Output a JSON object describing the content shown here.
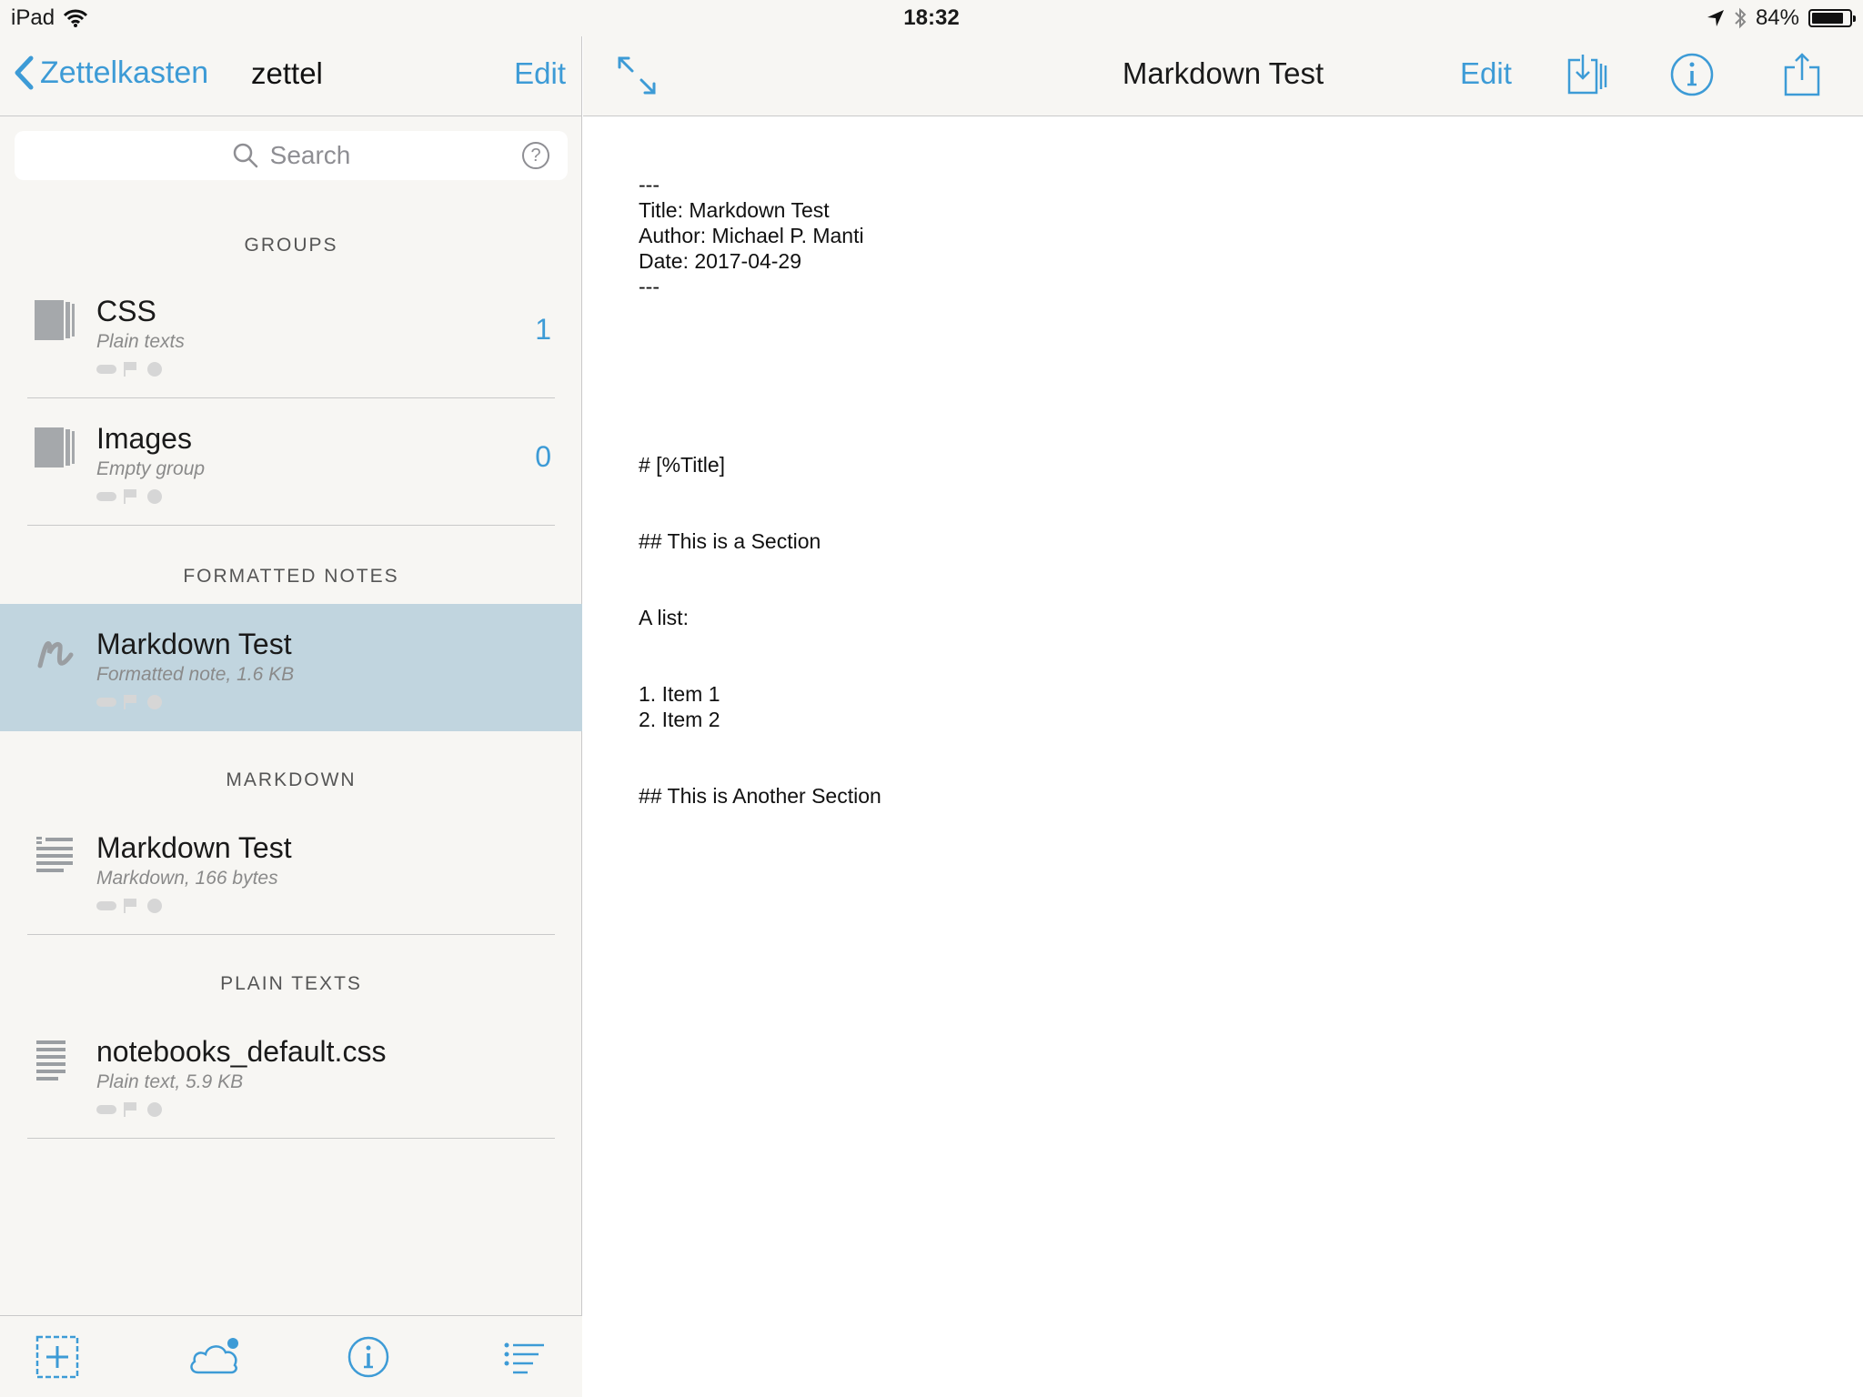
{
  "status_bar": {
    "device": "iPad",
    "time": "18:32",
    "battery_percent": "84%",
    "battery_level": 0.84,
    "icons": [
      "wifi-icon",
      "location-arrow-icon",
      "bluetooth-icon",
      "battery-icon"
    ]
  },
  "sidebar": {
    "back_label": "Zettelkasten",
    "title": "zettel",
    "edit_label": "Edit",
    "search": {
      "placeholder": "Search",
      "help_glyph": "?"
    },
    "sections": [
      {
        "header": "GROUPS",
        "items": [
          {
            "title": "CSS",
            "subtitle": "Plain texts",
            "count": "1",
            "icon": "group-folder-icon"
          },
          {
            "title": "Images",
            "subtitle": "Empty group",
            "count": "0",
            "icon": "group-folder-icon"
          }
        ]
      },
      {
        "header": "FORMATTED NOTES",
        "items": [
          {
            "title": "Markdown Test",
            "subtitle": "Formatted note, 1.6 KB",
            "icon": "formatted-note-icon",
            "selected": true
          }
        ]
      },
      {
        "header": "MARKDOWN",
        "items": [
          {
            "title": "Markdown Test",
            "subtitle": "Markdown, 166 bytes",
            "icon": "markdown-file-icon"
          }
        ]
      },
      {
        "header": "PLAIN TEXTS",
        "items": [
          {
            "title": "notebooks_default.css",
            "subtitle": "Plain text, 5.9 KB",
            "icon": "plain-text-file-icon"
          }
        ]
      }
    ],
    "toolbar": [
      "add-icon",
      "cloud-sync-icon",
      "info-icon",
      "list-icon"
    ]
  },
  "main": {
    "title": "Markdown Test",
    "edit_label": "Edit",
    "document_lines": [
      "---",
      "Title: Markdown Test",
      "Author: Michael P. Manti",
      "Date: 2017-04-29",
      "---",
      "# [%Title]",
      "## This is a Section",
      "A list:",
      "1. Item 1",
      "2. Item 2",
      "## This is Another Section"
    ]
  },
  "colors": {
    "accent": "#3d9bd6",
    "sidebar_bg": "#f7f6f3",
    "selected_row": "#c1d5df",
    "divider": "#c9c9c9"
  }
}
